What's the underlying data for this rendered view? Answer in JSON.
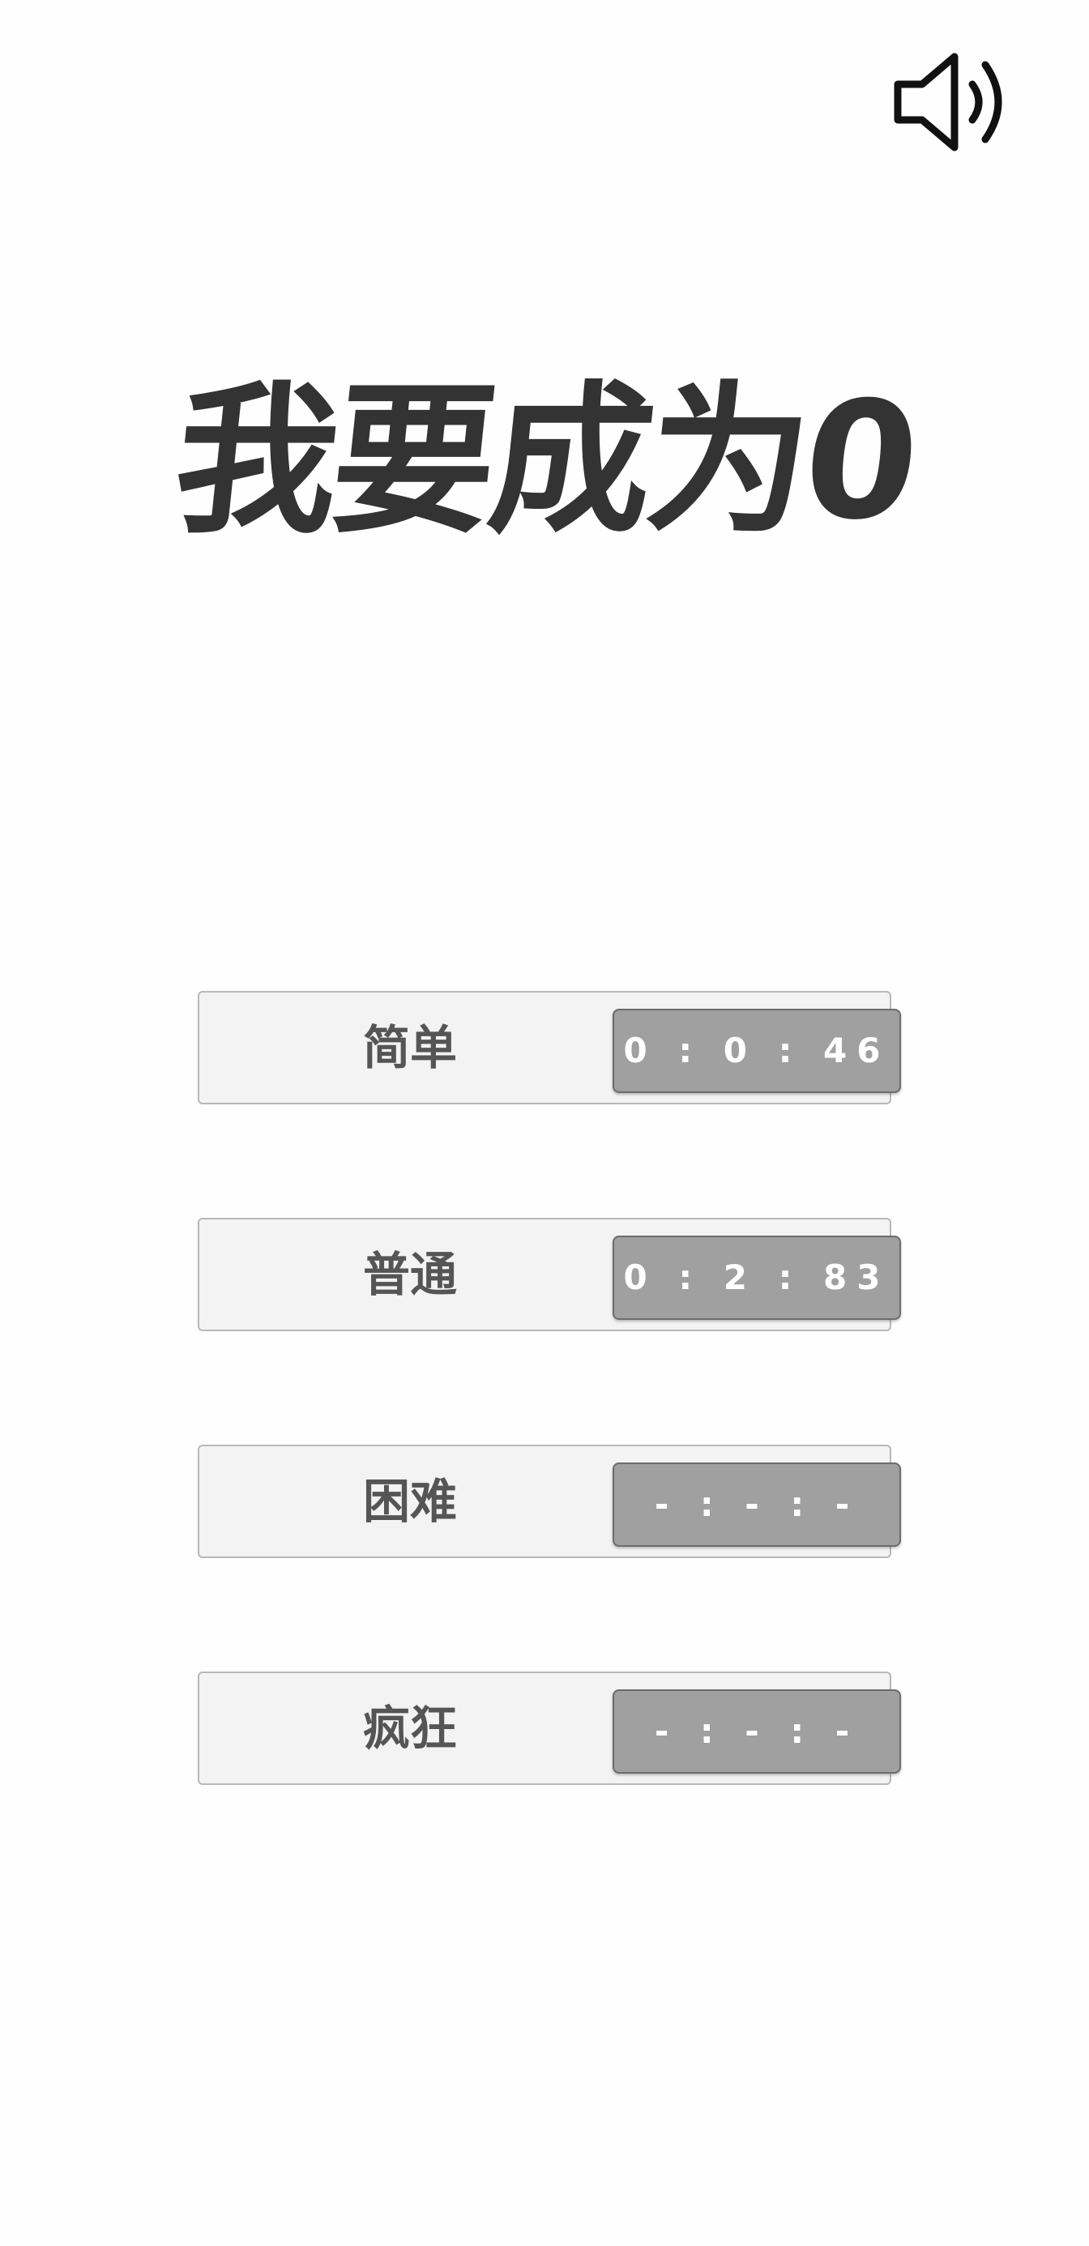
{
  "sound": {
    "icon": "speaker-on-icon",
    "color": "#111111"
  },
  "title": "我要成为0",
  "colors": {
    "title": "#333333",
    "level_button_bg": "#f3f3f3",
    "time_box_bg": "#a0a0a0",
    "time_text": "#ffffff"
  },
  "levels": [
    {
      "name": "简单",
      "time": "0 : 0 : 46"
    },
    {
      "name": "普通",
      "time": "0 : 2 : 83"
    },
    {
      "name": "困难",
      "time": "- : - : -"
    },
    {
      "name": "疯狂",
      "time": "- : - : -"
    }
  ]
}
